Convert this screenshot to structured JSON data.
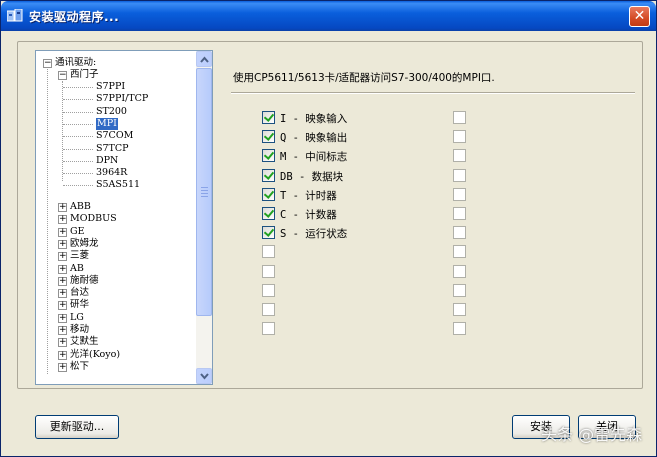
{
  "window": {
    "title": "安装驱动程序..."
  },
  "tree": {
    "root": "通讯驱动:",
    "siemens": "西门子",
    "siemens_children": [
      "S7PPI",
      "S7PPI/TCP",
      "ST200",
      "MPI",
      "S7COM",
      "S7TCP",
      "DPN",
      "3964R",
      "S5AS511"
    ],
    "selected": "MPI",
    "vendors": [
      "ABB",
      "MODBUS",
      "GE",
      "欧姆龙",
      "三菱",
      "AB",
      "施耐德",
      "台达",
      "研华",
      "LG",
      "移动",
      "艾默生",
      "光洋(Koyo)",
      "松下"
    ]
  },
  "description": "使用CP5611/5613卡/适配器访问S7-300/400的MPI口.",
  "checkboxes_left": [
    {
      "label": "I - 映象输入",
      "checked": true
    },
    {
      "label": "Q - 映象输出",
      "checked": true
    },
    {
      "label": "M - 中间标志",
      "checked": true
    },
    {
      "label": "DB - 数据块",
      "checked": true
    },
    {
      "label": "T - 计时器",
      "checked": true
    },
    {
      "label": "C - 计数器",
      "checked": true
    },
    {
      "label": "S - 运行状态",
      "checked": true
    },
    {
      "label": "",
      "checked": false
    },
    {
      "label": "",
      "checked": false
    },
    {
      "label": "",
      "checked": false
    },
    {
      "label": "",
      "checked": false
    },
    {
      "label": "",
      "checked": false
    }
  ],
  "buttons": {
    "update": "更新驱动...",
    "install": "安装",
    "close": "关闭"
  },
  "watermark": "头条 @雷先森",
  "icons": {
    "app": "app-icon",
    "close": "close-icon"
  }
}
